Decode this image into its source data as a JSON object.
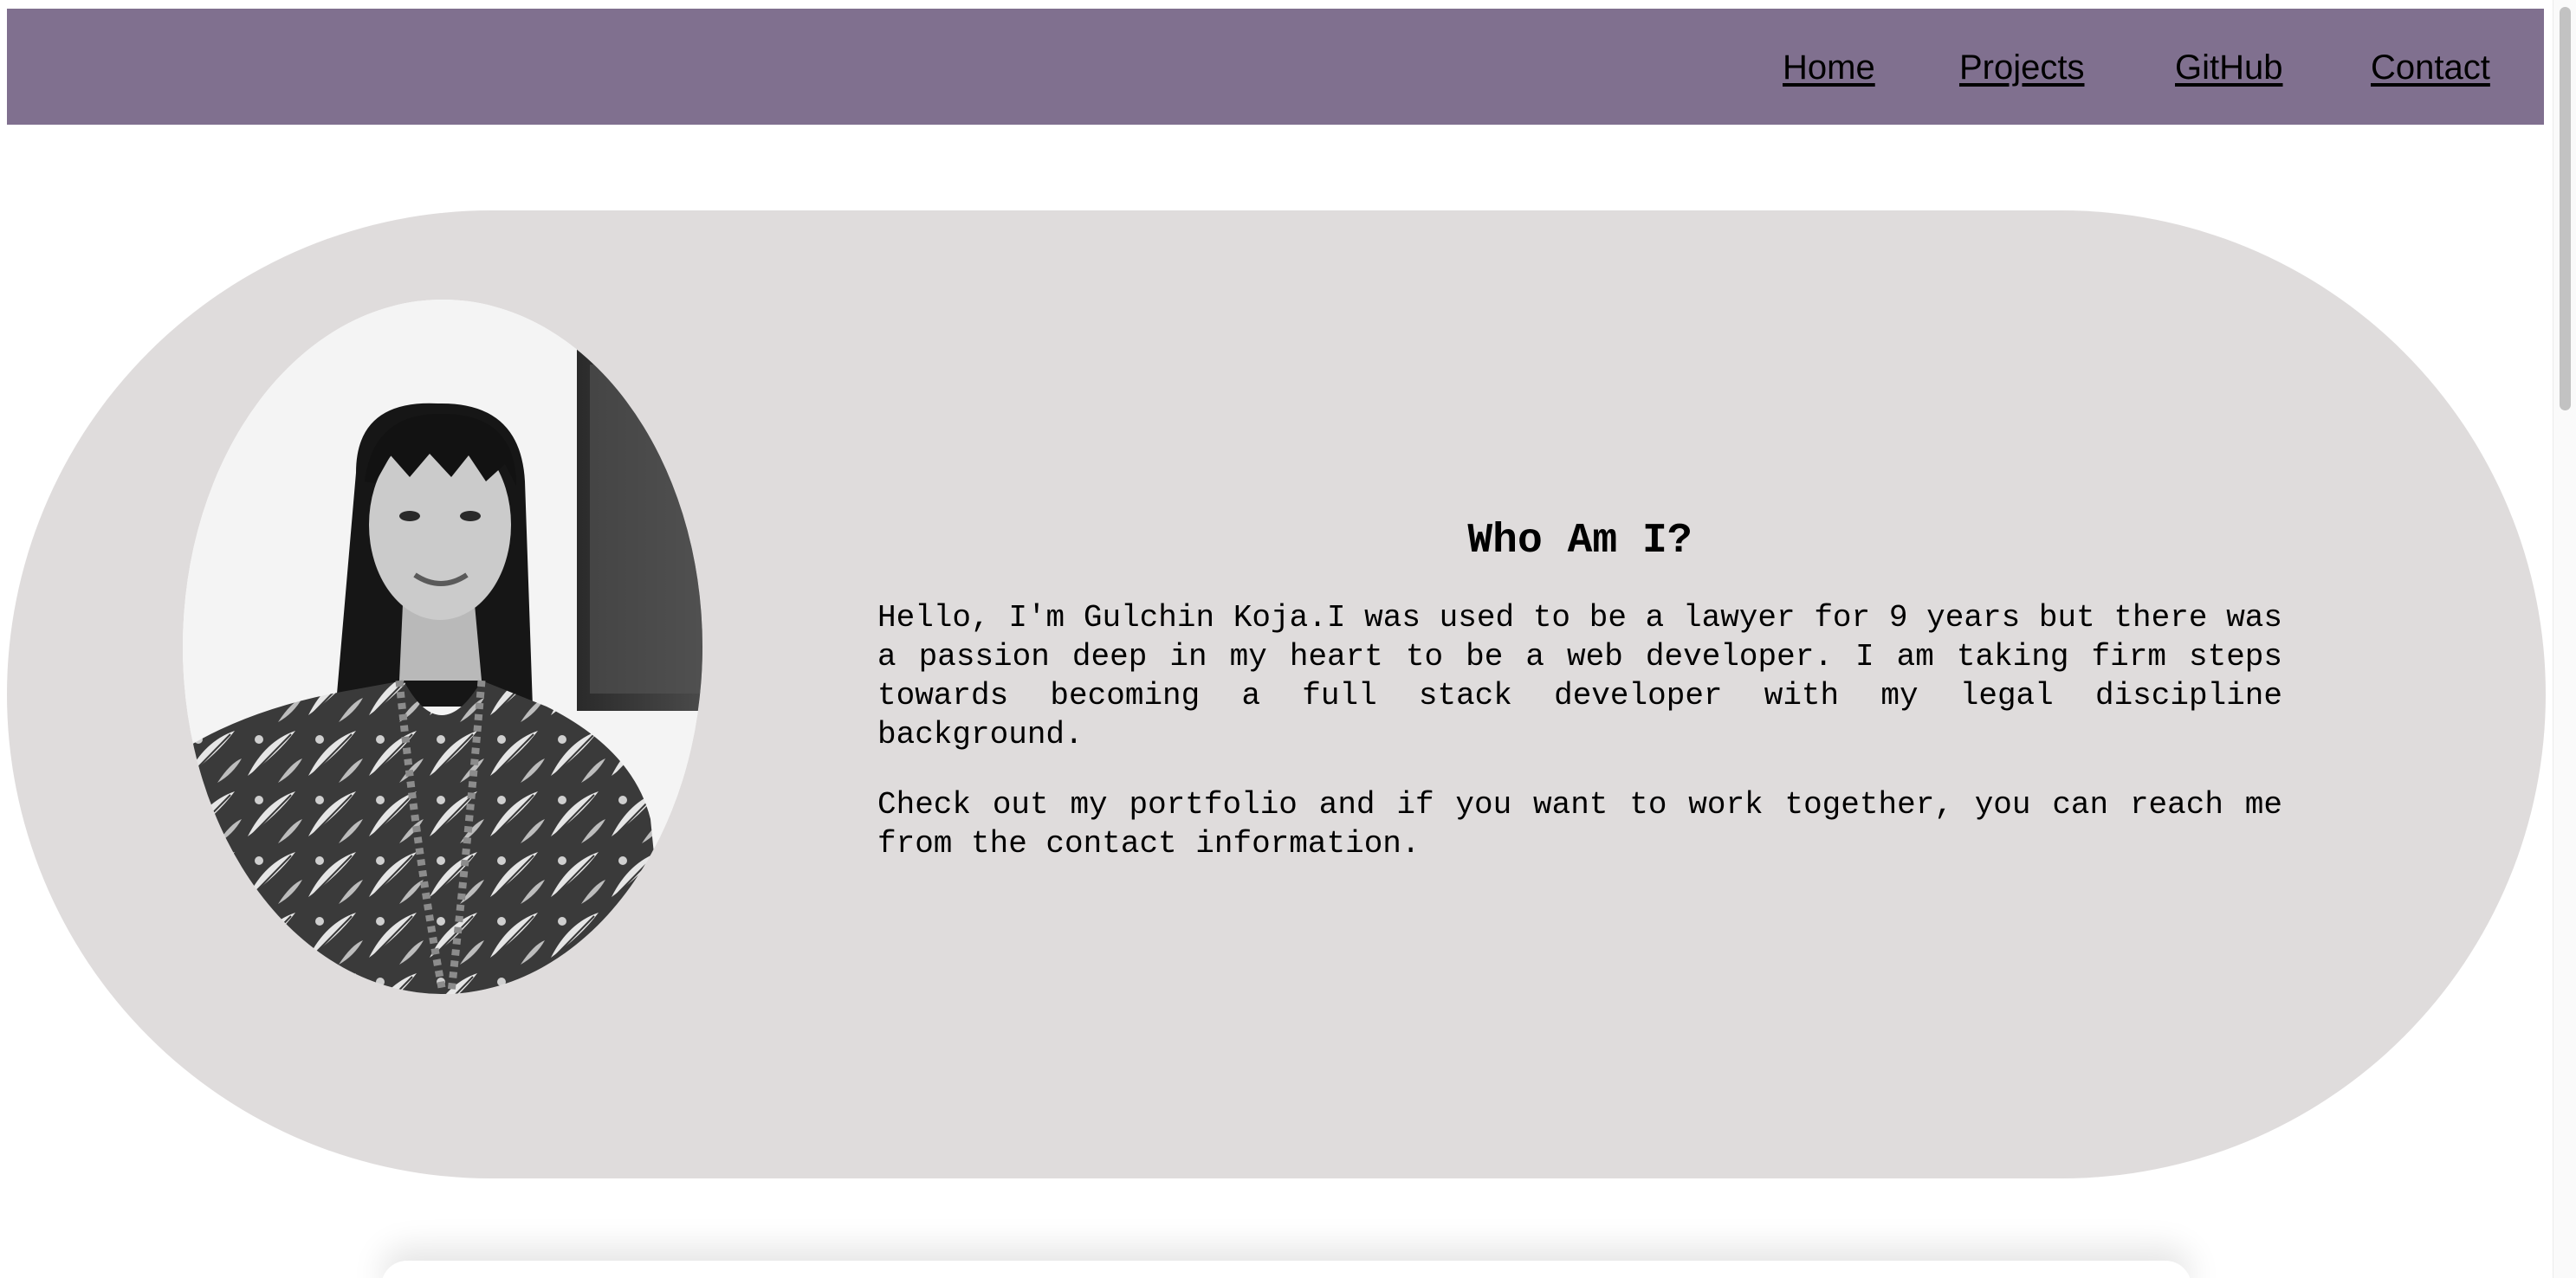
{
  "nav": {
    "home": "Home",
    "projects": "Projects",
    "github": "GitHub",
    "contact": "Contact"
  },
  "about": {
    "heading": "Who Am I?",
    "paragraph1": "Hello, I'm Gulchin Koja.I was used to be a lawyer for 9 years but there was a passion deep in my heart to be a web developer. I am taking firm steps towards becoming a full stack developer with my legal discipline background.",
    "paragraph2": "Check out my portfolio and if you want to work together, you can reach me from the contact information."
  },
  "colors": {
    "navbar": "#80708f",
    "hero_background": "#dfdcdc",
    "text": "#000000"
  }
}
